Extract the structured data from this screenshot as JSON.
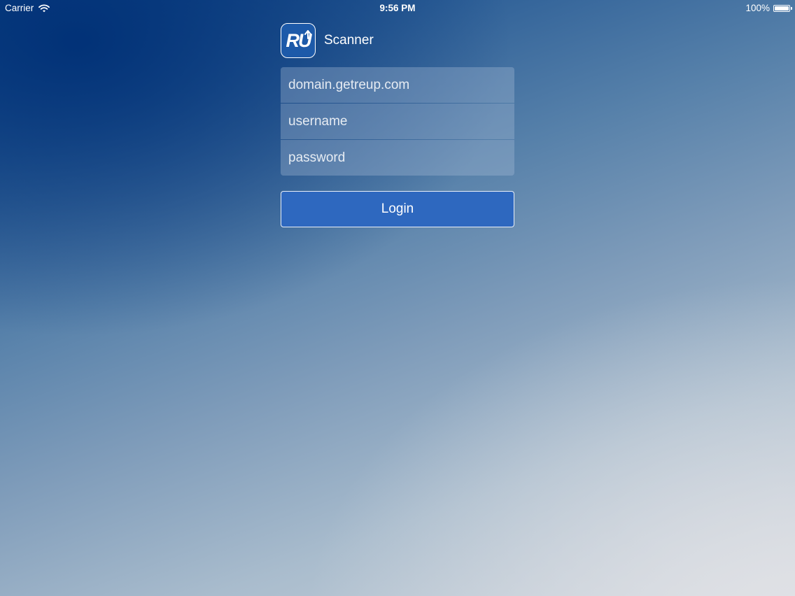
{
  "status_bar": {
    "carrier": "Carrier",
    "time": "9:56 PM",
    "battery_percent_label": "100%",
    "battery_level": 1.0,
    "icons": [
      "wifi-icon",
      "battery-icon"
    ]
  },
  "header": {
    "logo_text": "RU",
    "title": "Scanner"
  },
  "form": {
    "domain": {
      "placeholder": "domain.getreup.com",
      "value": ""
    },
    "username": {
      "placeholder": "username",
      "value": ""
    },
    "password": {
      "placeholder": "password",
      "value": ""
    },
    "login_label": "Login"
  },
  "colors": {
    "accent": "#2e68bf",
    "logo_background": "#1d5aa9",
    "text": "#ffffff"
  }
}
